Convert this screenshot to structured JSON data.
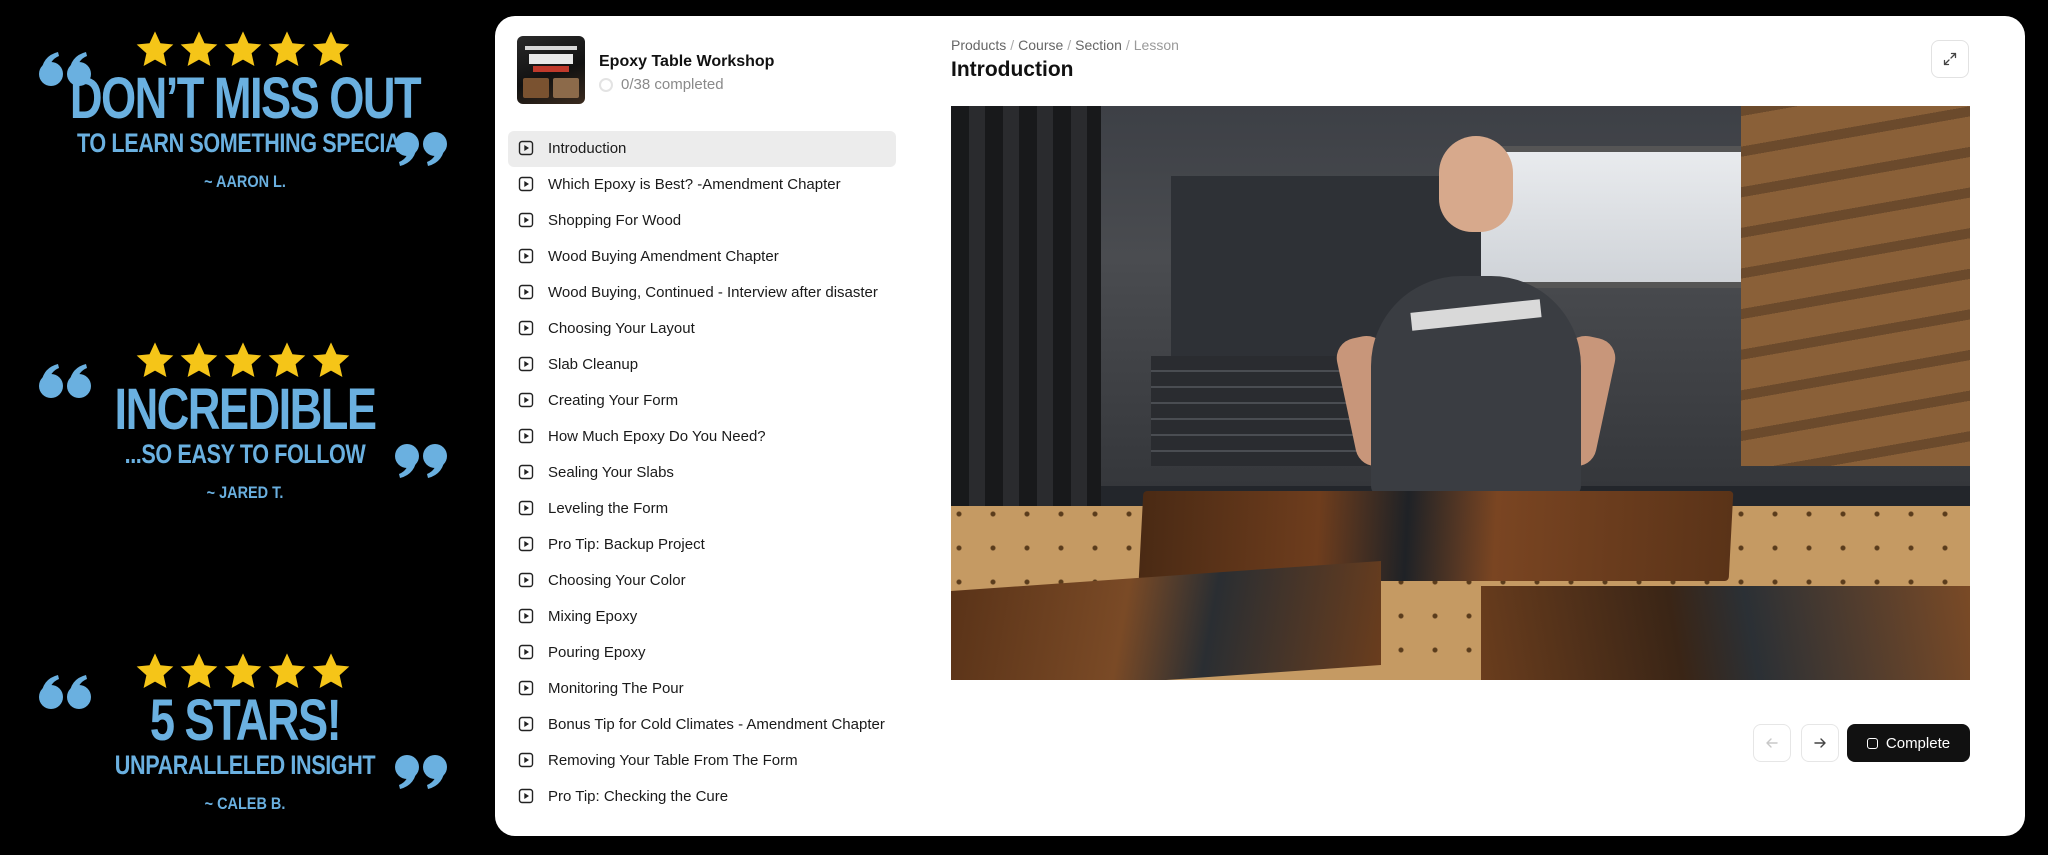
{
  "testimonials": [
    {
      "headline": "DON’T MISS OUT",
      "sub": "TO LEARN SOMETHING SPECIAL",
      "author": "~ AARON L.",
      "rating": 5
    },
    {
      "headline": "INCREDIBLE",
      "sub": "...SO EASY TO FOLLOW",
      "author": "~ JARED T.",
      "rating": 5
    },
    {
      "headline": "5 STARS!",
      "sub": "UNPARALLELED INSIGHT",
      "author": "~ CALEB B.",
      "rating": 5
    }
  ],
  "colors": {
    "testimonial_blue": "#6ab0e0",
    "star_yellow": "#f5c518",
    "button_dark": "#111111"
  },
  "course": {
    "title": "Epoxy Table Workshop",
    "progress": "0/38 completed"
  },
  "lessons": [
    {
      "label": "Introduction",
      "active": true
    },
    {
      "label": "Which Epoxy is Best? -Amendment Chapter"
    },
    {
      "label": "Shopping For Wood"
    },
    {
      "label": "Wood Buying Amendment Chapter"
    },
    {
      "label": "Wood Buying, Continued - Interview after disaster"
    },
    {
      "label": "Choosing Your Layout"
    },
    {
      "label": "Slab Cleanup"
    },
    {
      "label": "Creating Your Form"
    },
    {
      "label": "How Much Epoxy Do You Need?"
    },
    {
      "label": "Sealing Your Slabs"
    },
    {
      "label": "Leveling the Form"
    },
    {
      "label": "Pro Tip: Backup Project"
    },
    {
      "label": "Choosing Your Color"
    },
    {
      "label": "Mixing Epoxy"
    },
    {
      "label": "Pouring Epoxy"
    },
    {
      "label": "Monitoring The Pour"
    },
    {
      "label": "Bonus Tip for Cold Climates - Amendment Chapter"
    },
    {
      "label": "Removing Your Table From The Form"
    },
    {
      "label": "Pro Tip: Checking the Cure"
    }
  ],
  "breadcrumb": [
    "Products",
    "Course",
    "Section",
    "Lesson"
  ],
  "lesson": {
    "title": "Introduction"
  },
  "controls": {
    "complete_label": "Complete",
    "prev_icon": "arrow-left-icon",
    "next_icon": "arrow-right-icon",
    "expand_icon": "expand-icon"
  }
}
